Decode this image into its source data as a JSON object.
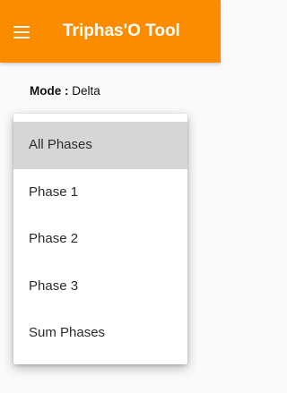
{
  "appbar": {
    "title": "Triphas'O Tool",
    "menu_icon": "hamburger-menu-icon",
    "color": "#fb8c00"
  },
  "mode": {
    "label": "Mode :",
    "value": "Delta"
  },
  "dropdown": {
    "selected_index": 0,
    "selected_color": "#d6d6d6",
    "items": [
      {
        "label": "All Phases"
      },
      {
        "label": "Phase 1"
      },
      {
        "label": "Phase 2"
      },
      {
        "label": "Phase 3"
      },
      {
        "label": "Sum Phases"
      }
    ]
  }
}
